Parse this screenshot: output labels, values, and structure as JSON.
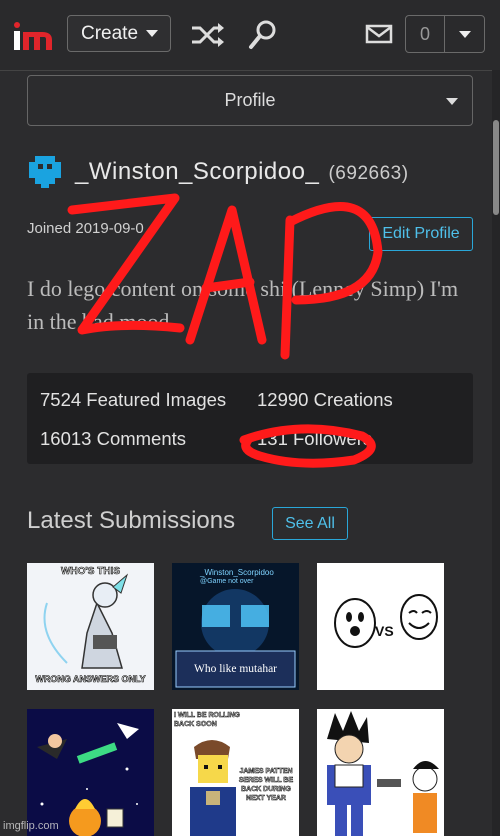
{
  "header": {
    "create_label": "Create",
    "notif_count": "0"
  },
  "profile_select": {
    "label": "Profile"
  },
  "user": {
    "name": "_Winston_Scorpidoo_",
    "points": "(692663)",
    "joined": "Joined 2019-09-0",
    "edit_label": "Edit Profile",
    "bio": "I do lego content on some shi (Lenney Simp) I'm in the bad mood"
  },
  "stats": {
    "featured": "7524 Featured Images",
    "creations": "12990 Creations",
    "comments": "16013 Comments",
    "followers": "131 Followers"
  },
  "latest": {
    "title": "Latest Submissions",
    "see_all_label": "See All",
    "thumbs": [
      {
        "top_text": "WHO'S THIS",
        "bottom_text": "WRONG ANSWERS ONLY"
      },
      {
        "top_text": "_Winston_Scorpidoo",
        "sub_text": "@Game not over",
        "bottom_text": "Who like mutahar"
      },
      {
        "text": "VS"
      },
      {
        "text": ""
      },
      {
        "top_text": "I WILL BE ROLLING BACK SOON",
        "bottom_text": "JAMES PATTEN SERES WILL BE BACK DURING NEXT YEAR"
      },
      {
        "text": ""
      }
    ]
  },
  "overlay": {
    "scribble_text": "ZAP"
  },
  "watermark": "imgflip.com",
  "colors": {
    "accent": "#2aa7d8",
    "logo_red": "#e1252b",
    "scribble": "#ff1a1a",
    "avatar": "#1aa3e0"
  }
}
